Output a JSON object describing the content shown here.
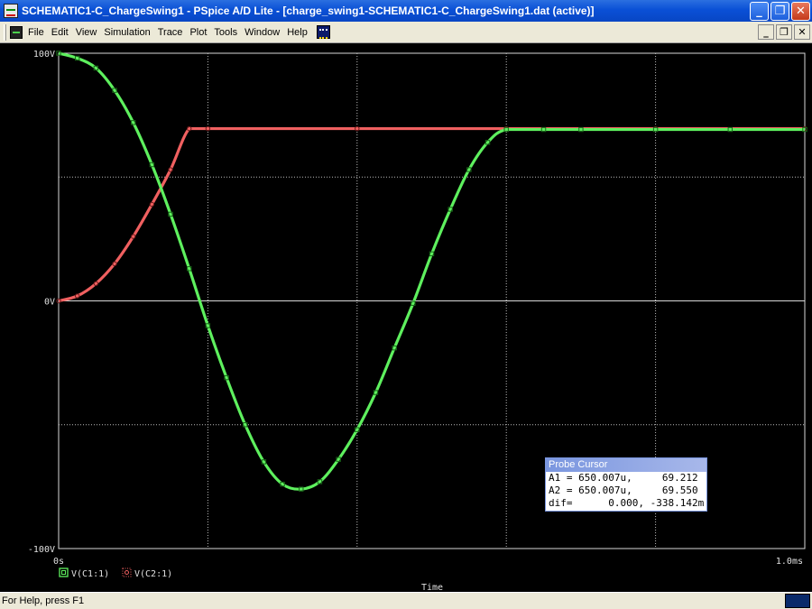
{
  "window": {
    "title": "SCHEMATIC1-C_ChargeSwing1 - PSpice A/D Lite  - [charge_swing1-SCHEMATIC1-C_ChargeSwing1.dat (active)]",
    "buttons": {
      "minimize": "_",
      "maximize": "❐",
      "close": "✕"
    }
  },
  "menu": {
    "items": [
      "File",
      "Edit",
      "View",
      "Simulation",
      "Trace",
      "Plot",
      "Tools",
      "Window",
      "Help"
    ],
    "mdi_buttons": {
      "minimize": "_",
      "restore": "❐",
      "close": "✕"
    }
  },
  "chart_data": {
    "type": "line",
    "xlabel": "Time",
    "x_range": [
      0,
      1.0
    ],
    "x_unit": "ms",
    "x_tick_labels": [
      "0s",
      "1.0ms"
    ],
    "ylim": [
      -100,
      100
    ],
    "y_tick_labels": [
      "100V",
      "0V",
      "-100V"
    ],
    "grid": true,
    "legend_position": "bottom-left",
    "series": [
      {
        "name": "V(C1:1)",
        "color": "#5ef05e",
        "marker": "square",
        "points": [
          [
            0.0,
            100
          ],
          [
            0.025,
            98
          ],
          [
            0.05,
            94
          ],
          [
            0.075,
            85
          ],
          [
            0.1,
            72
          ],
          [
            0.125,
            55
          ],
          [
            0.15,
            35
          ],
          [
            0.175,
            13
          ],
          [
            0.2,
            -10
          ],
          [
            0.225,
            -31
          ],
          [
            0.25,
            -50
          ],
          [
            0.275,
            -65
          ],
          [
            0.3,
            -74
          ],
          [
            0.325,
            -76
          ],
          [
            0.35,
            -73
          ],
          [
            0.375,
            -64
          ],
          [
            0.4,
            -52
          ],
          [
            0.425,
            -37
          ],
          [
            0.45,
            -19
          ],
          [
            0.475,
            -1
          ],
          [
            0.5,
            19
          ],
          [
            0.525,
            37
          ],
          [
            0.55,
            53
          ],
          [
            0.575,
            64
          ],
          [
            0.6,
            69.2
          ],
          [
            0.65,
            69.2
          ],
          [
            0.7,
            69.2
          ],
          [
            0.8,
            69.2
          ],
          [
            0.9,
            69.2
          ],
          [
            1.0,
            69.2
          ]
        ]
      },
      {
        "name": "V(C2:1)",
        "color": "#f06060",
        "marker": "circle",
        "points": [
          [
            0.0,
            0
          ],
          [
            0.025,
            2
          ],
          [
            0.05,
            7
          ],
          [
            0.075,
            15
          ],
          [
            0.1,
            26
          ],
          [
            0.125,
            39
          ],
          [
            0.15,
            53
          ],
          [
            0.175,
            69.55
          ],
          [
            0.2,
            69.55
          ],
          [
            0.4,
            69.55
          ],
          [
            0.6,
            69.55
          ],
          [
            0.8,
            69.55
          ],
          [
            1.0,
            69.55
          ]
        ]
      }
    ]
  },
  "probe_cursor": {
    "title": "Probe Cursor",
    "rows": [
      "A1 = 650.007u,     69.212",
      "A2 = 650.007u,     69.550",
      "dif=      0.000, -338.142m"
    ]
  },
  "status": {
    "help_text": "For Help, press F1"
  }
}
